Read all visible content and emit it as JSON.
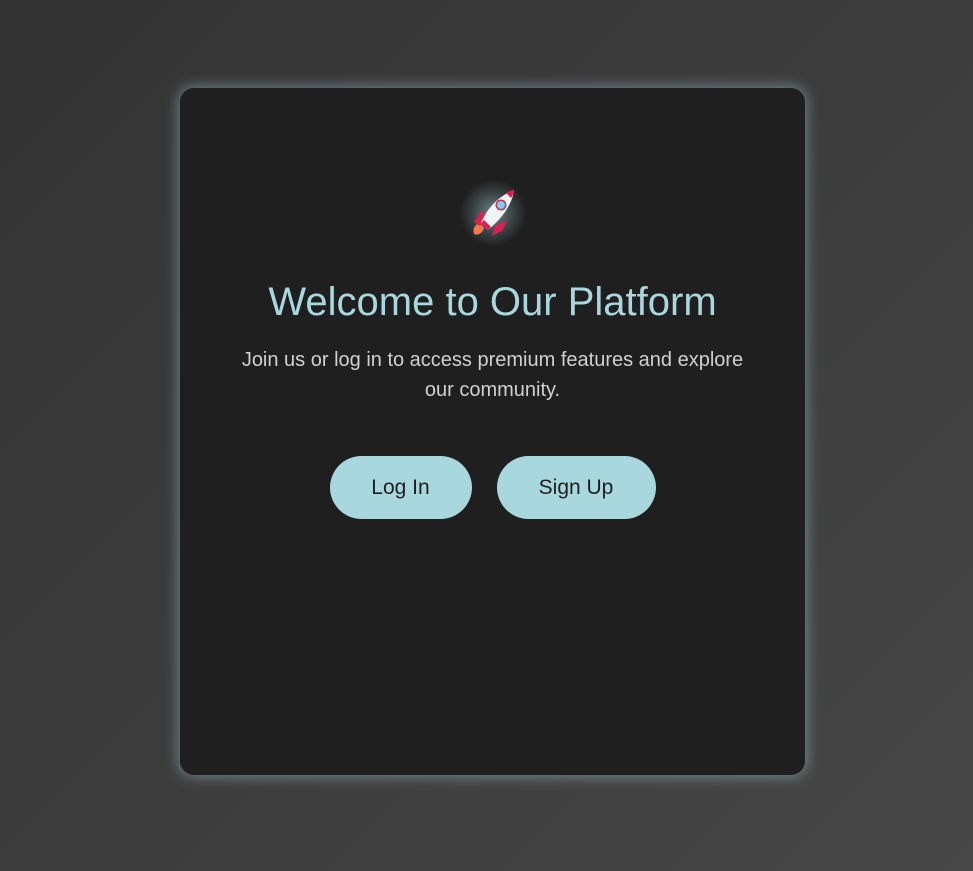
{
  "card": {
    "icon": "rocket-icon",
    "title": "Welcome to Our Platform",
    "subtitle": "Join us or log in to access premium features and explore our community.",
    "buttons": {
      "login_label": "Log In",
      "signup_label": "Sign Up"
    }
  },
  "colors": {
    "accent": "#a8d8de",
    "card_background": "#1f1f1f",
    "page_background": "#3c3c3c",
    "subtitle_text": "#d0d0d0"
  }
}
